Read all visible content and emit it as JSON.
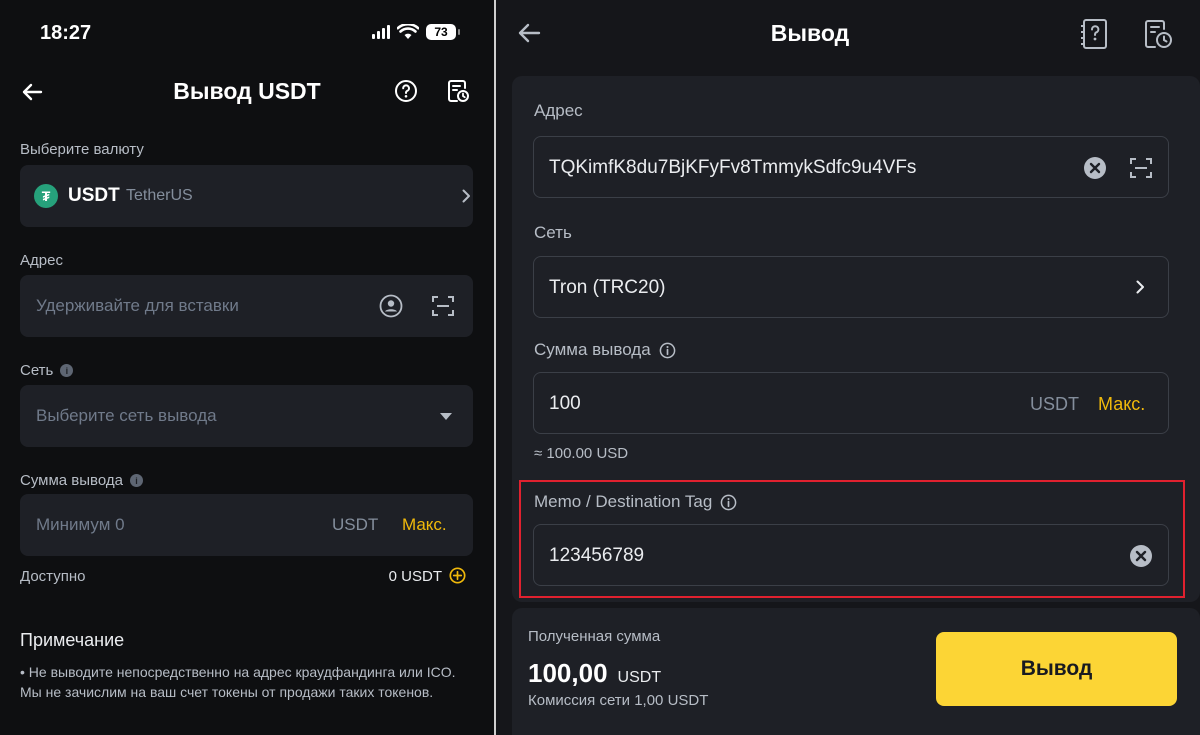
{
  "left": {
    "status": {
      "time": "18:27",
      "battery": "73"
    },
    "header": {
      "title": "Вывод USDT"
    },
    "currency": {
      "label": "Выберите валюту",
      "symbol": "USDT",
      "name": "TetherUS"
    },
    "address": {
      "label": "Адрес",
      "placeholder": "Удерживайте для вставки"
    },
    "network": {
      "label": "Сеть",
      "placeholder": "Выберите сеть вывода"
    },
    "amount": {
      "label": "Сумма вывода",
      "placeholder": "Минимум 0",
      "unit": "USDT",
      "max": "Макс."
    },
    "available": {
      "label": "Доступно",
      "value": "0 USDT"
    },
    "note": {
      "title": "Примечание",
      "text": "• Не выводите непосредственно на адрес краудфандинга или ICO. Мы не зачислим на ваш счет токены от продажи таких токенов."
    }
  },
  "right": {
    "header": {
      "title": "Вывод"
    },
    "address": {
      "label": "Адрес",
      "value": "TQKimfK8du7BjKFyFv8TmmykSdfc9u4VFs"
    },
    "network": {
      "label": "Сеть",
      "value": "Tron (TRC20)"
    },
    "amount": {
      "label": "Сумма вывода",
      "value": "100",
      "unit": "USDT",
      "max": "Макс.",
      "approx": "≈ 100.00 USD"
    },
    "memo": {
      "label": "Memo / Destination Tag",
      "value": "123456789"
    },
    "receive": {
      "label": "Полученная сумма",
      "amount": "100,00",
      "unit": "USDT",
      "fee": "Комиссия сети 1,00 USDT"
    },
    "submit_label": "Вывод"
  },
  "colors": {
    "accent": "#fcd535",
    "link": "#f0b90b",
    "highlight": "#e0212f",
    "tether": "#26a17b"
  }
}
